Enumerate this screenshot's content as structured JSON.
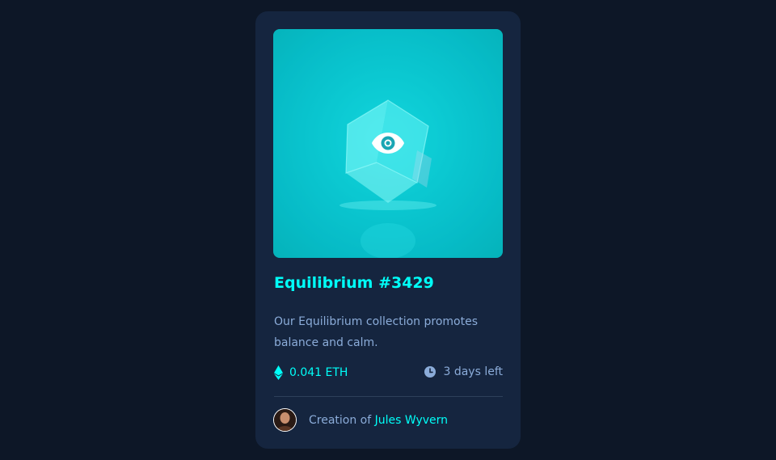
{
  "card": {
    "title": "Equilibrium #3429",
    "description": "Our Equilibrium collection promotes balance and calm.",
    "price": "0.041 ETH",
    "time_left": "3 days left",
    "creator_prefix": "Creation of",
    "creator_name": "Jules Wyvern"
  },
  "icons": {
    "price": "ethereum-icon",
    "time": "clock-icon",
    "overlay": "view-eye-icon"
  },
  "colors": {
    "page_bg": "#0d1727",
    "card_bg": "#15253f",
    "accent_cyan": "#00fff8",
    "soft_blue": "#8bacd9",
    "divider": "#2e405a"
  }
}
